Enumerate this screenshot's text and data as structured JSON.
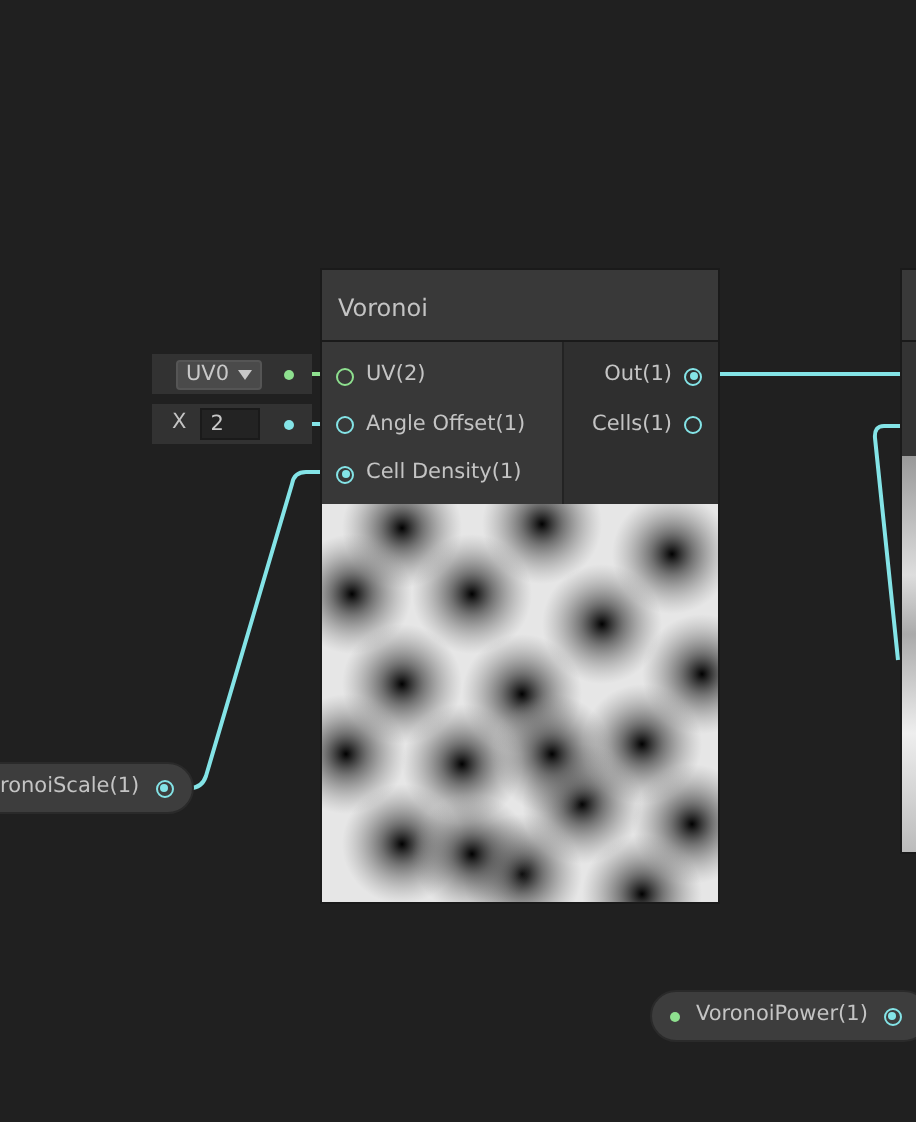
{
  "node": {
    "title": "Voronoi",
    "inputs": [
      {
        "label": "UV(2)",
        "connected": false,
        "color": "#8ee08f"
      },
      {
        "label": "Angle Offset(1)",
        "connected": false,
        "color": "#84e4e7"
      },
      {
        "label": "Cell Density(1)",
        "connected": true,
        "color": "#84e4e7"
      }
    ],
    "outputs": [
      {
        "label": "Out(1)",
        "connected": true,
        "color": "#84e4e7"
      },
      {
        "label": "Cells(1)",
        "connected": false,
        "color": "#84e4e7"
      }
    ]
  },
  "inline_inputs": [
    {
      "kind": "dropdown",
      "value": "UV0",
      "color": "#8ee08f"
    },
    {
      "kind": "vector",
      "axis": "X",
      "value": "2",
      "color": "#84e4e7"
    }
  ],
  "properties": [
    {
      "label": "ronoiScale(1)",
      "connected": true,
      "color": "#84e4e7"
    },
    {
      "label": "VoronoiPower(1)",
      "connected": true,
      "color": "#84e4e7",
      "input_dot": {
        "color": "#8ee08f"
      }
    }
  ]
}
